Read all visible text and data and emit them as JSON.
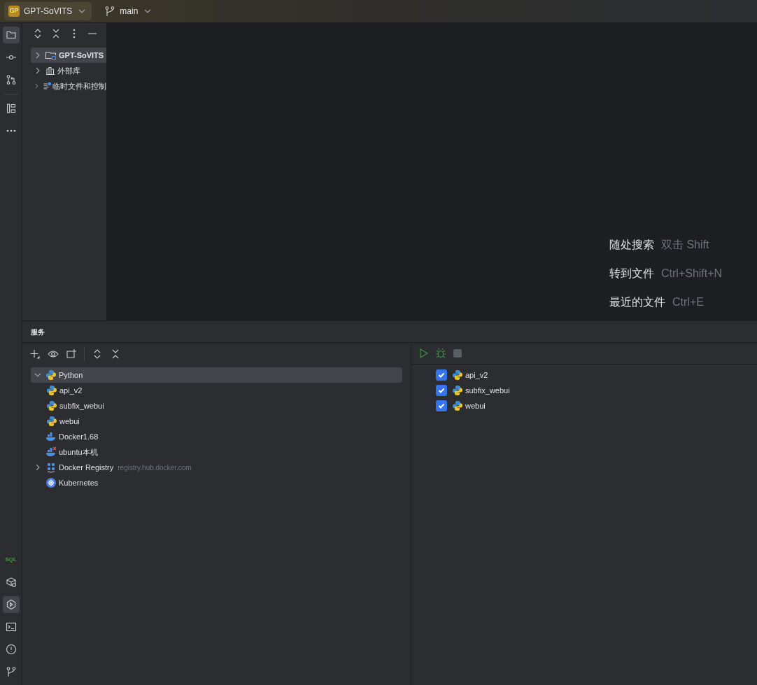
{
  "top_bar": {
    "project_badge": "GP",
    "project_name": "GPT-SoVITS",
    "branch": "main"
  },
  "tool_rail": {
    "top": [
      {
        "kind": "folder",
        "selected": true
      },
      {
        "kind": "commit",
        "selected": false
      },
      {
        "kind": "pull",
        "selected": false
      },
      {
        "kind": "structure",
        "selected": false
      },
      {
        "kind": "more",
        "selected": false
      }
    ],
    "bottom": [
      {
        "kind": "sql",
        "label": "SQL",
        "selected": false
      },
      {
        "kind": "cube",
        "selected": false
      },
      {
        "kind": "services",
        "selected": true
      },
      {
        "kind": "terminal",
        "selected": false
      },
      {
        "kind": "problems",
        "selected": false
      },
      {
        "kind": "git",
        "selected": false
      }
    ]
  },
  "project_tree": [
    {
      "label": "GPT-SoVITS",
      "kind": "project",
      "selected": true
    },
    {
      "label": "外部库",
      "kind": "library",
      "selected": false
    },
    {
      "label": "临时文件和控制",
      "kind": "scratch",
      "selected": false
    }
  ],
  "editor_hints": [
    {
      "action": "随处搜索",
      "shortcut": "双击 Shift"
    },
    {
      "action": "转到文件",
      "shortcut": "Ctrl+Shift+N"
    },
    {
      "action": "最近的文件",
      "shortcut": "Ctrl+E"
    }
  ],
  "services": {
    "title": "服务",
    "tree": [
      {
        "label": "Python",
        "kind": "python",
        "expanded": true,
        "selected": true,
        "children": [
          {
            "label": "api_v2",
            "kind": "python",
            "selected": false
          },
          {
            "label": "subfix_webui",
            "kind": "python",
            "selected": false
          },
          {
            "label": "webui",
            "kind": "python",
            "selected": false
          }
        ]
      },
      {
        "label": "Docker1.68",
        "kind": "docker",
        "selected": false
      },
      {
        "label": "ubuntu本机",
        "kind": "docker-error",
        "selected": false
      },
      {
        "label": "Docker Registry",
        "hint": "registry.hub.docker.com",
        "kind": "registry",
        "expanded": false,
        "selected": false
      },
      {
        "label": "Kubernetes",
        "kind": "kubernetes",
        "selected": false
      }
    ],
    "targets": [
      {
        "label": "api_v2",
        "checked": true
      },
      {
        "label": "subfix_webui",
        "checked": true
      },
      {
        "label": "webui",
        "checked": true
      }
    ]
  }
}
